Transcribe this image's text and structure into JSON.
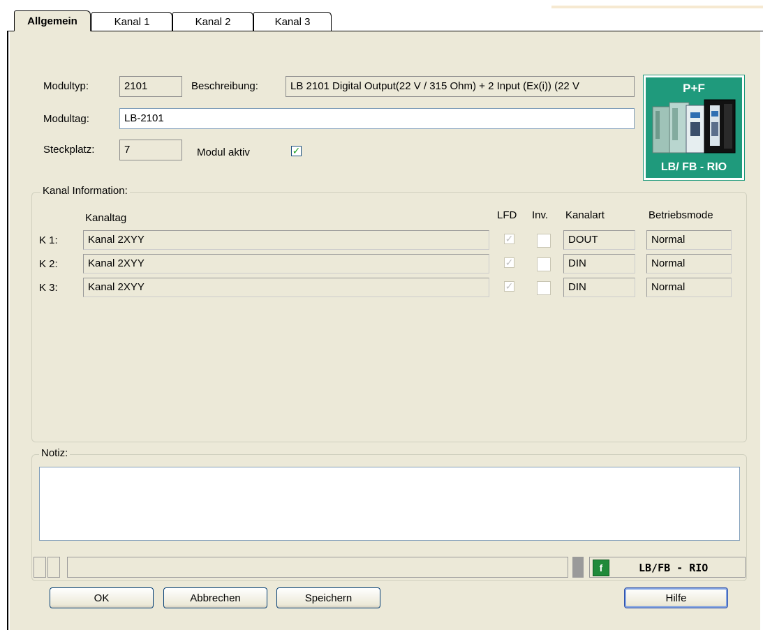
{
  "tabs": [
    {
      "label": "Allgemein"
    },
    {
      "label": "Kanal 1"
    },
    {
      "label": "Kanal 2"
    },
    {
      "label": "Kanal 3"
    }
  ],
  "module": {
    "modultyp_label": "Modultyp:",
    "modultyp_value": "2101",
    "beschreibung_label": "Beschreibung:",
    "beschreibung_value": "LB 2101 Digital Output(22 V / 315 Ohm)  +  2 Input (Ex(i)) (22 V",
    "modultag_label": "Modultag:",
    "modultag_value": "LB-2101",
    "steckplatz_label": "Steckplatz:",
    "steckplatz_value": "7",
    "aktiv_label": "Modul aktiv",
    "aktiv_checked": true
  },
  "logo": {
    "top_text": "P+F",
    "bottom_text": "LB/ FB - RIO"
  },
  "kanal": {
    "group_title": "Kanal Information:",
    "headers": {
      "kanaltag": "Kanaltag",
      "lfd": "LFD",
      "inv": "Inv.",
      "kanalart": "Kanalart",
      "betriebsmode": "Betriebsmode"
    },
    "rows": [
      {
        "id": "K 1:",
        "tag": "Kanal 2XYY",
        "lfd": true,
        "inv": false,
        "art": "DOUT",
        "mode": "Normal"
      },
      {
        "id": "K 2:",
        "tag": "Kanal 2XYY",
        "lfd": true,
        "inv": false,
        "art": "DIN",
        "mode": "Normal"
      },
      {
        "id": "K 3:",
        "tag": "Kanal 2XYY",
        "lfd": true,
        "inv": false,
        "art": "DIN",
        "mode": "Normal"
      }
    ]
  },
  "notiz": {
    "title": "Notiz:",
    "value": ""
  },
  "status": {
    "brand_text": "LB/FB - RIO"
  },
  "buttons": {
    "ok": "OK",
    "abbrechen": "Abbrechen",
    "speichern": "Speichern",
    "hilfe": "Hilfe"
  },
  "colors": {
    "panel": "#ece9d8",
    "logo_green": "#1f9a7c",
    "check_green": "#21a121"
  }
}
